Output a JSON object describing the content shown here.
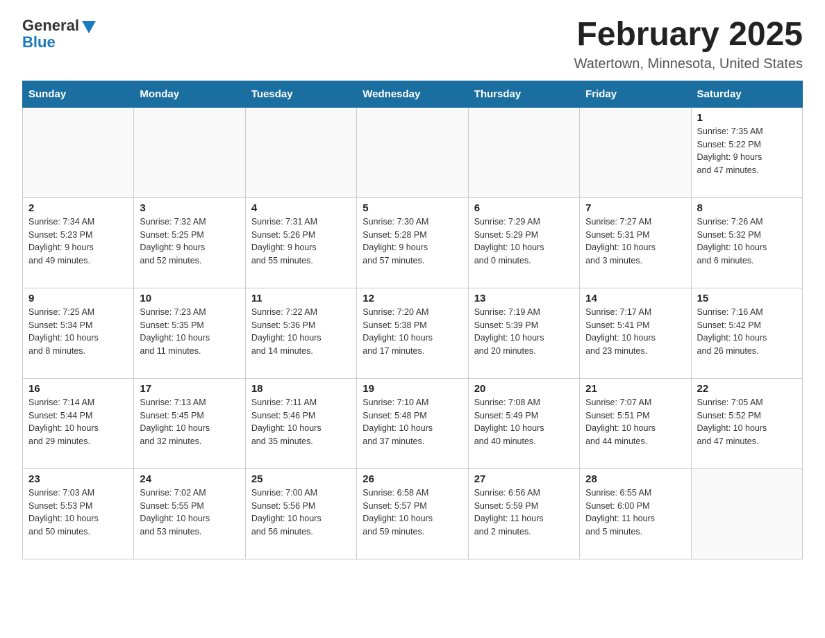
{
  "header": {
    "logo_general": "General",
    "logo_blue": "Blue",
    "month_title": "February 2025",
    "location": "Watertown, Minnesota, United States"
  },
  "days_of_week": [
    "Sunday",
    "Monday",
    "Tuesday",
    "Wednesday",
    "Thursday",
    "Friday",
    "Saturday"
  ],
  "weeks": [
    [
      {
        "day": "",
        "info": ""
      },
      {
        "day": "",
        "info": ""
      },
      {
        "day": "",
        "info": ""
      },
      {
        "day": "",
        "info": ""
      },
      {
        "day": "",
        "info": ""
      },
      {
        "day": "",
        "info": ""
      },
      {
        "day": "1",
        "info": "Sunrise: 7:35 AM\nSunset: 5:22 PM\nDaylight: 9 hours\nand 47 minutes."
      }
    ],
    [
      {
        "day": "2",
        "info": "Sunrise: 7:34 AM\nSunset: 5:23 PM\nDaylight: 9 hours\nand 49 minutes."
      },
      {
        "day": "3",
        "info": "Sunrise: 7:32 AM\nSunset: 5:25 PM\nDaylight: 9 hours\nand 52 minutes."
      },
      {
        "day": "4",
        "info": "Sunrise: 7:31 AM\nSunset: 5:26 PM\nDaylight: 9 hours\nand 55 minutes."
      },
      {
        "day": "5",
        "info": "Sunrise: 7:30 AM\nSunset: 5:28 PM\nDaylight: 9 hours\nand 57 minutes."
      },
      {
        "day": "6",
        "info": "Sunrise: 7:29 AM\nSunset: 5:29 PM\nDaylight: 10 hours\nand 0 minutes."
      },
      {
        "day": "7",
        "info": "Sunrise: 7:27 AM\nSunset: 5:31 PM\nDaylight: 10 hours\nand 3 minutes."
      },
      {
        "day": "8",
        "info": "Sunrise: 7:26 AM\nSunset: 5:32 PM\nDaylight: 10 hours\nand 6 minutes."
      }
    ],
    [
      {
        "day": "9",
        "info": "Sunrise: 7:25 AM\nSunset: 5:34 PM\nDaylight: 10 hours\nand 8 minutes."
      },
      {
        "day": "10",
        "info": "Sunrise: 7:23 AM\nSunset: 5:35 PM\nDaylight: 10 hours\nand 11 minutes."
      },
      {
        "day": "11",
        "info": "Sunrise: 7:22 AM\nSunset: 5:36 PM\nDaylight: 10 hours\nand 14 minutes."
      },
      {
        "day": "12",
        "info": "Sunrise: 7:20 AM\nSunset: 5:38 PM\nDaylight: 10 hours\nand 17 minutes."
      },
      {
        "day": "13",
        "info": "Sunrise: 7:19 AM\nSunset: 5:39 PM\nDaylight: 10 hours\nand 20 minutes."
      },
      {
        "day": "14",
        "info": "Sunrise: 7:17 AM\nSunset: 5:41 PM\nDaylight: 10 hours\nand 23 minutes."
      },
      {
        "day": "15",
        "info": "Sunrise: 7:16 AM\nSunset: 5:42 PM\nDaylight: 10 hours\nand 26 minutes."
      }
    ],
    [
      {
        "day": "16",
        "info": "Sunrise: 7:14 AM\nSunset: 5:44 PM\nDaylight: 10 hours\nand 29 minutes."
      },
      {
        "day": "17",
        "info": "Sunrise: 7:13 AM\nSunset: 5:45 PM\nDaylight: 10 hours\nand 32 minutes."
      },
      {
        "day": "18",
        "info": "Sunrise: 7:11 AM\nSunset: 5:46 PM\nDaylight: 10 hours\nand 35 minutes."
      },
      {
        "day": "19",
        "info": "Sunrise: 7:10 AM\nSunset: 5:48 PM\nDaylight: 10 hours\nand 37 minutes."
      },
      {
        "day": "20",
        "info": "Sunrise: 7:08 AM\nSunset: 5:49 PM\nDaylight: 10 hours\nand 40 minutes."
      },
      {
        "day": "21",
        "info": "Sunrise: 7:07 AM\nSunset: 5:51 PM\nDaylight: 10 hours\nand 44 minutes."
      },
      {
        "day": "22",
        "info": "Sunrise: 7:05 AM\nSunset: 5:52 PM\nDaylight: 10 hours\nand 47 minutes."
      }
    ],
    [
      {
        "day": "23",
        "info": "Sunrise: 7:03 AM\nSunset: 5:53 PM\nDaylight: 10 hours\nand 50 minutes."
      },
      {
        "day": "24",
        "info": "Sunrise: 7:02 AM\nSunset: 5:55 PM\nDaylight: 10 hours\nand 53 minutes."
      },
      {
        "day": "25",
        "info": "Sunrise: 7:00 AM\nSunset: 5:56 PM\nDaylight: 10 hours\nand 56 minutes."
      },
      {
        "day": "26",
        "info": "Sunrise: 6:58 AM\nSunset: 5:57 PM\nDaylight: 10 hours\nand 59 minutes."
      },
      {
        "day": "27",
        "info": "Sunrise: 6:56 AM\nSunset: 5:59 PM\nDaylight: 11 hours\nand 2 minutes."
      },
      {
        "day": "28",
        "info": "Sunrise: 6:55 AM\nSunset: 6:00 PM\nDaylight: 11 hours\nand 5 minutes."
      },
      {
        "day": "",
        "info": ""
      }
    ]
  ]
}
